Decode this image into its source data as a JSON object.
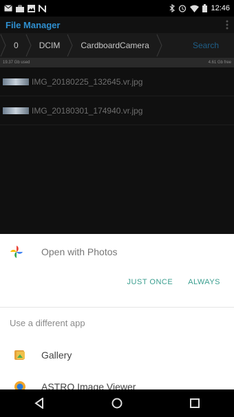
{
  "status_bar": {
    "time": "12:46",
    "left_icons": [
      "email-icon",
      "briefcase-icon",
      "image-icon",
      "n-icon"
    ],
    "right_icons": [
      "bluetooth-icon",
      "alarm-icon",
      "wifi-icon",
      "battery-icon"
    ]
  },
  "app_bar": {
    "title": "File Manager"
  },
  "path_bar": {
    "crumbs": [
      "0",
      "DCIM",
      "CardboardCamera"
    ],
    "search_label": "Search"
  },
  "storage": {
    "used": "19.37 Gb used",
    "free": "4.61 Gb free"
  },
  "files": [
    {
      "name": "IMG_20180225_132645.vr.jpg"
    },
    {
      "name": "IMG_20180301_174940.vr.jpg"
    }
  ],
  "sheet": {
    "open_with_label": "Open with Photos",
    "just_once": "JUST ONCE",
    "always": "ALWAYS",
    "different_app_label": "Use a different app",
    "apps": [
      {
        "label": "Gallery",
        "icon": "gallery-icon"
      },
      {
        "label": "ASTRO Image Viewer",
        "icon": "astro-icon"
      }
    ]
  },
  "nav_bar": {
    "buttons": [
      "back-icon",
      "home-icon",
      "recents-icon"
    ]
  }
}
